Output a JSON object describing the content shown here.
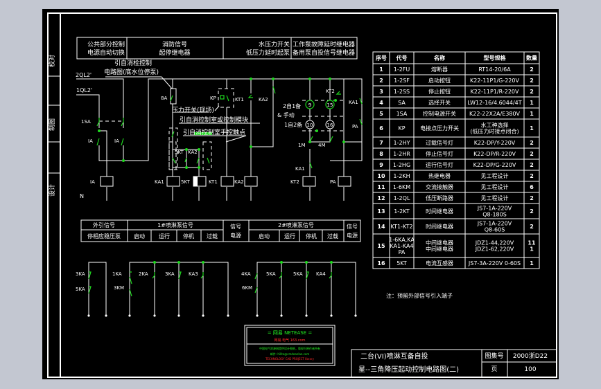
{
  "colors": {
    "background": "#000000",
    "line": "#ffffff",
    "contact": "#1fd91f",
    "outer": "#c3c7d1",
    "logo_green": "#22ee22",
    "logo_red": "#ff2a2a"
  },
  "side_labels": [
    "校对",
    "制图",
    "设计"
  ],
  "header_table": [
    [
      "公共部分控制",
      "电源自动切换"
    ],
    [
      "消防信号",
      "起停继电器"
    ],
    [
      "水压力开关",
      "低压力延时起泵"
    ],
    [
      "工作泵故障延时继电器",
      "备用泵自投信号继电器"
    ]
  ],
  "circuit": {
    "notes": [
      "引自消栓控制",
      "电路图(底水位停泵)",
      "压力开关(现场)",
      "引自消控制室或控制模块",
      "引自消控制室手控触点"
    ],
    "inputs": [
      "2QL2'",
      "1QL2'"
    ],
    "neutral": "N",
    "contacts": [
      "1SA",
      "IA",
      "IA",
      "8A",
      "KP",
      "KT1",
      "KA2",
      "5KT",
      "KA2",
      "KT2",
      "KA1",
      "PA",
      "1M",
      "4M",
      "KA1"
    ],
    "mode_labels": [
      "2自1备",
      "& 手动",
      "1自2备"
    ],
    "lamps": [
      "9",
      "15",
      "10",
      "16"
    ],
    "coils": [
      "IA",
      "KA1",
      "5KT",
      "KT1",
      "KA2",
      "KT2",
      "PA"
    ]
  },
  "signal_table": {
    "col1": [
      "外引信号",
      "停相应稳压泵"
    ],
    "group1": "1#喷淋泵信号",
    "group2": "2#喷淋泵信号",
    "sub": [
      "启动",
      "运行",
      "停机",
      "过载"
    ],
    "power": [
      "信号",
      "电源"
    ]
  },
  "terminals": {
    "labels": [
      "3KA",
      "5KA",
      "1KA",
      "3KM",
      "2KA",
      "3KA",
      "KA3",
      "4KA",
      "6KM",
      "5KA",
      "5KA",
      "KA4"
    ]
  },
  "parts_table": {
    "headers": [
      "序号",
      "代号",
      "名称",
      "型号规格",
      "数量"
    ],
    "rows": [
      [
        "1",
        "1-2FU",
        "熔断器",
        "RT14-20/6A",
        "2"
      ],
      [
        "2",
        "1-2SF",
        "启动按钮",
        "K22-11P1/G-220V",
        "2"
      ],
      [
        "3",
        "1-2SS",
        "停止按钮",
        "K22-11P1/R-220V",
        "2"
      ],
      [
        "4",
        "SA",
        "选择开关",
        "LW12-16/4.6044/4T",
        "1"
      ],
      [
        "5",
        "1SA",
        "控制电源开关",
        "K22-22X2A/E380V",
        "1"
      ],
      [
        "6",
        "KP",
        "电接点压力开关",
        "水工种选择\n(低压力时接点闭合)",
        "1"
      ],
      [
        "7",
        "1-2HY",
        "过载信号灯",
        "K22-DP/Y-220V",
        "2"
      ],
      [
        "8",
        "1-2HR",
        "停止信号灯",
        "K22-DP/R-220V",
        "2"
      ],
      [
        "9",
        "1-2HG",
        "运行信号灯",
        "K22-DP/G-220V",
        "2"
      ],
      [
        "10",
        "1-2KH",
        "热继电器",
        "见工程设计",
        "2"
      ],
      [
        "11",
        "1-6KM",
        "交流接触器",
        "见工程设计",
        "6"
      ],
      [
        "12",
        "1-2QL",
        "低压断路器",
        "见工程设计",
        "2"
      ],
      [
        "13",
        "1-2KT",
        "时间继电器",
        "JS7-1A-220V\nQ8-180S",
        "2"
      ],
      [
        "14",
        "KT1-KT2",
        "时间继电器",
        "JS7-1A-220V\nQ8-60S",
        "2"
      ],
      [
        "15",
        "1-6KA,KA\nKA1-KA4\nPA",
        "中间继电器\n中间继电器",
        "JDZ1-44,220V\nJDZ1-62,220V",
        "11\n1"
      ],
      [
        "16",
        "5KT",
        "电流互感器",
        "JS7-3A-220V 0-60S",
        "1"
      ]
    ]
  },
  "note": "注：预留外部信号引入端子",
  "stamp": {
    "line1": "= 网易 NETEASE =",
    "line2": "网易.电气 163.com",
    "line3": "中国电气资源网提供设计图纸，版权归原作者所有",
    "line4": "邮件: hilite@cmdeanlan.com",
    "line5": "TECHNOLOGY CAD PROJECT library"
  },
  "title_block": {
    "title1": "二台(VI)喷淋互备自投",
    "title2": "星--三角降压起动控制电路图(二)",
    "drawing_no_label": "图集号",
    "drawing_no": "2000浙D22",
    "page_label": "页",
    "page": "100"
  }
}
